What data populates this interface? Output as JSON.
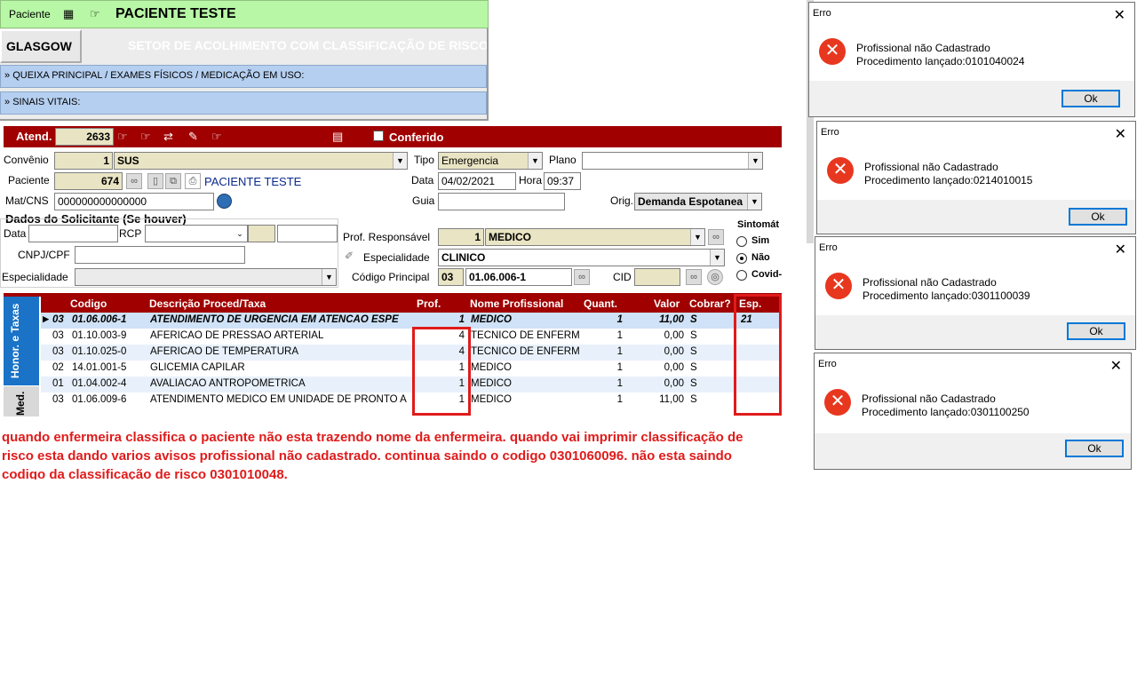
{
  "top": {
    "patient_label": "Paciente",
    "patient_name": "PACIENTE TESTE",
    "glasgow_button": "GLASGOW",
    "sector_title": "SETOR DE ACOLHIMENTO COM CLASSIFICAÇÃO DE RISCO",
    "section1": "QUEIXA PRINCIPAL / EXAMES FÍSICOS / MEDICAÇÃO EM USO:",
    "section2": "SINAIS VITAIS:",
    "expand_glyph": "»"
  },
  "atend_bar": {
    "label": "Atend.",
    "number": "2633",
    "conferido_label": "Conferido"
  },
  "form": {
    "convenio_label": "Convênio",
    "convenio_code": "1",
    "convenio_name": "SUS",
    "tipo_label": "Tipo",
    "tipo_value": "Emergencia",
    "plano_label": "Plano",
    "plano_value": "",
    "paciente_label": "Paciente",
    "paciente_code": "674",
    "paciente_name": "PACIENTE TESTE",
    "data_label": "Data",
    "data_value": "04/02/2021",
    "hora_label": "Hora",
    "hora_value": "09:37",
    "matcns_label": "Mat/CNS",
    "matcns_value": "000000000000000",
    "guia_label": "Guia",
    "orig_label": "Orig.",
    "orig_value": "Demanda Espotanea",
    "solicitante_title": "Dados do Solicitante (Se houver)",
    "sol_data_label": "Data",
    "rcp_label": "RCP",
    "cnpj_label": "CNPJ/CPF",
    "especialidade_left_label": "Especialidade",
    "prof_resp_label": "Prof. Responsável",
    "prof_code": "1",
    "prof_name": "MEDICO",
    "especialidade_label": "Especialidade",
    "especialidade_value": "CLINICO",
    "cod_principal_label": "Código Principal",
    "cod_principal_short": "03",
    "cod_principal_value": "01.06.006-1",
    "cid_label": "CID",
    "sintomat_label": "Sintomát",
    "radio_sim": "Sim",
    "radio_nao": "Não",
    "radio_covid": "Covid-"
  },
  "side_tabs": {
    "honor": "Honor. e Taxas",
    "med": "Med."
  },
  "grid": {
    "headers": [
      "Codigo",
      "Descrição Proced/Taxa",
      "Prof.",
      "Nome Profissional",
      "Quant.",
      "Valor",
      "Cobrar?",
      "Esp."
    ],
    "rows": [
      {
        "g": "03",
        "code": "01.06.006-1",
        "desc": "ATENDIMENTO DE URGENCIA EM ATENCAO ESPE",
        "prof": "1",
        "name": "MEDICO",
        "qty": "1",
        "valor": "11,00",
        "cobrar": "S",
        "esp": "21"
      },
      {
        "g": "03",
        "code": "01.10.003-9",
        "desc": "AFERICAO DE PRESSAO ARTERIAL",
        "prof": "4",
        "name": "TECNICO DE ENFERM",
        "qty": "1",
        "valor": "0,00",
        "cobrar": "S",
        "esp": ""
      },
      {
        "g": "03",
        "code": "01.10.025-0",
        "desc": "AFERICAO DE TEMPERATURA",
        "prof": "4",
        "name": "TECNICO DE ENFERM",
        "qty": "1",
        "valor": "0,00",
        "cobrar": "S",
        "esp": ""
      },
      {
        "g": "02",
        "code": "14.01.001-5",
        "desc": "GLICEMIA CAPILAR",
        "prof": "1",
        "name": "MEDICO",
        "qty": "1",
        "valor": "0,00",
        "cobrar": "S",
        "esp": ""
      },
      {
        "g": "01",
        "code": "01.04.002-4",
        "desc": "AVALIACAO ANTROPOMETRICA",
        "prof": "1",
        "name": "MEDICO",
        "qty": "1",
        "valor": "0,00",
        "cobrar": "S",
        "esp": ""
      },
      {
        "g": "03",
        "code": "01.06.009-6",
        "desc": "ATENDIMENTO MEDICO EM UNIDADE DE PRONTO A",
        "prof": "1",
        "name": "MEDICO",
        "qty": "1",
        "valor": "11,00",
        "cobrar": "S",
        "esp": ""
      }
    ]
  },
  "note": {
    "line1": "quando enfermeira classifica o paciente não esta trazendo nome da enfermeira. quando vai imprimir classificação de",
    "line2": "risco esta dando varios avisos profissional não cadastrado. continua saindo o codigo 0301060096. não esta saindo",
    "line3": "codigo da classificação de risco 0301010048."
  },
  "dialogs": [
    {
      "title": "Erro",
      "msg1": "Profissional não Cadastrado",
      "msg2": "Procedimento lançado:0101040024",
      "ok": "Ok"
    },
    {
      "title": "Erro",
      "msg1": "Profissional não Cadastrado",
      "msg2": "Procedimento lançado:0214010015",
      "ok": "Ok"
    },
    {
      "title": "Erro",
      "msg1": "Profissional não Cadastrado",
      "msg2": "Procedimento lançado:0301100039",
      "ok": "Ok"
    },
    {
      "title": "Erro",
      "msg1": "Profissional não Cadastrado",
      "msg2": "Procedimento lançado:0301100250",
      "ok": "Ok"
    }
  ],
  "colors": {
    "header_green": "#b7f7a5",
    "atend_red": "#a00000",
    "section_blue": "#b5cff0",
    "field_beige": "#e9e4c3",
    "annotation_red": "#e01b1b",
    "error_red": "#e8371f"
  }
}
